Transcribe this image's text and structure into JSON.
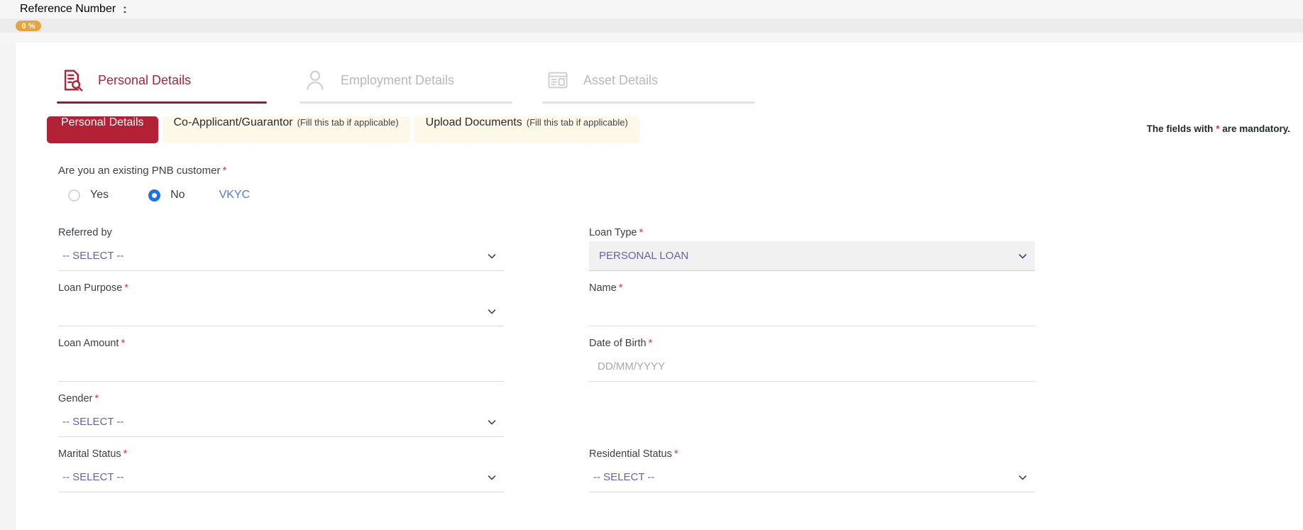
{
  "header": {
    "reference_label": "Reference Number",
    "reference_colon": ":",
    "reference_value": "",
    "progress_text": "0 %",
    "progress_percent": 0
  },
  "colors": {
    "brand_red": "#a8253b",
    "subtab_active_bg": "#b22134",
    "subtab_passive_bg": "#fdf8e8",
    "progress_orange": "#e8a33d",
    "radio_blue": "#1a73e8",
    "link_blue": "#4a7fd4",
    "required_star": "#d13b4b",
    "select_value_purple": "#6b5fa8",
    "placeholder_gray": "#a9a9a9"
  },
  "main_tabs": [
    {
      "label": "Personal Details",
      "icon": "document-search-icon",
      "active": true
    },
    {
      "label": "Employment Details",
      "icon": "person-icon",
      "active": false
    },
    {
      "label": "Asset Details",
      "icon": "asset-card-icon",
      "active": false
    }
  ],
  "sub_tabs": [
    {
      "label": "Personal Details",
      "note": "",
      "active": true
    },
    {
      "label": "Co-Applicant/Guarantor",
      "note": "(Fill this tab if applicable)",
      "active": false
    },
    {
      "label": "Upload Documents",
      "note": "(Fill this tab if applicable)",
      "active": false
    }
  ],
  "mandatory_note": {
    "before": "The fields with ",
    "star": "*",
    "after": " are mandatory."
  },
  "question": {
    "label": "Are you an existing PNB customer",
    "required": "*",
    "options": [
      {
        "label": "Yes",
        "selected": false
      },
      {
        "label": "No",
        "selected": true
      }
    ],
    "vkyc_link": "VKYC"
  },
  "fields": [
    {
      "id": "referred-by",
      "label": "Referred by",
      "required": "",
      "type": "select",
      "value": "-- SELECT --",
      "placeholder": "",
      "filled": false,
      "column": "left"
    },
    {
      "id": "loan-type",
      "label": "Loan Type",
      "required": "*",
      "type": "select",
      "value": "PERSONAL LOAN",
      "placeholder": "",
      "filled": true,
      "column": "right"
    },
    {
      "id": "loan-purpose",
      "label": "Loan Purpose",
      "required": "*",
      "type": "select",
      "value": "",
      "placeholder": "",
      "filled": false,
      "column": "left"
    },
    {
      "id": "name",
      "label": "Name",
      "required": "*",
      "type": "text",
      "value": "",
      "placeholder": "",
      "filled": false,
      "column": "right"
    },
    {
      "id": "loan-amount",
      "label": "Loan Amount",
      "required": "*",
      "type": "text",
      "value": "",
      "placeholder": "",
      "filled": false,
      "column": "left"
    },
    {
      "id": "date-of-birth",
      "label": "Date of Birth",
      "required": "*",
      "type": "text",
      "value": "",
      "placeholder": "DD/MM/YYYY",
      "filled": false,
      "column": "right"
    },
    {
      "id": "gender",
      "label": "Gender",
      "required": "*",
      "type": "select",
      "value": "-- SELECT --",
      "placeholder": "",
      "filled": false,
      "column": "left"
    },
    {
      "id": "right-blank-1",
      "label": "",
      "required": "",
      "type": "blank",
      "value": "",
      "placeholder": "",
      "filled": false,
      "column": "right"
    },
    {
      "id": "marital-status",
      "label": "Marital Status",
      "required": "*",
      "type": "select",
      "value": "-- SELECT --",
      "placeholder": "",
      "filled": false,
      "column": "left"
    },
    {
      "id": "residential-status",
      "label": "Residential Status",
      "required": "*",
      "type": "select",
      "value": "-- SELECT --",
      "placeholder": "",
      "filled": false,
      "column": "right"
    }
  ]
}
